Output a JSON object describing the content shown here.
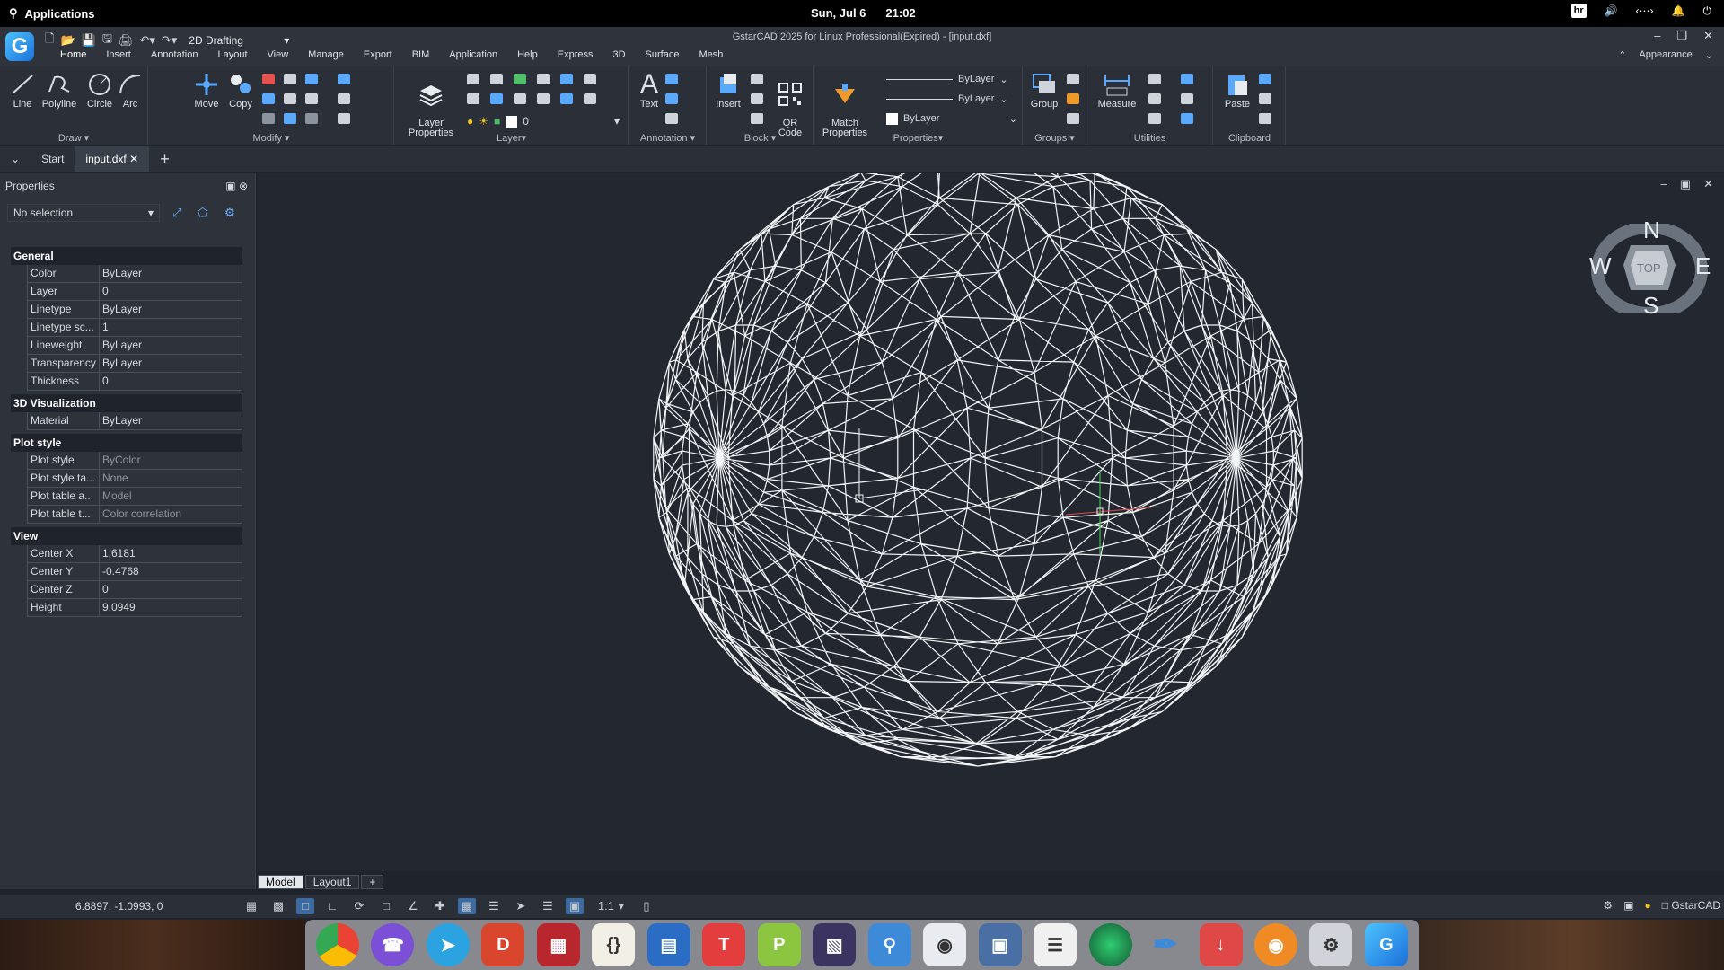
{
  "system_bar": {
    "apps_label": "Applications",
    "date": "Sun, Jul  6",
    "time": "21:02",
    "keyboard_layout": "hr"
  },
  "app": {
    "title": "GstarCAD 2025 for Linux Professional(Expired) - [input.dxf]",
    "workspace": "2D Drafting",
    "appearance_label": "Appearance",
    "menu": [
      "Home",
      "Insert",
      "Annotation",
      "Layout",
      "View",
      "Manage",
      "Export",
      "BIM",
      "Application",
      "Help",
      "Express",
      "3D",
      "Surface",
      "Mesh"
    ]
  },
  "ribbon": {
    "draw": {
      "title": "Draw",
      "line": "Line",
      "polyline": "Polyline",
      "circle": "Circle",
      "arc": "Arc"
    },
    "modify": {
      "title": "Modify",
      "move": "Move",
      "copy": "Copy"
    },
    "layer": {
      "title": "Layer",
      "layer_properties": "Layer\nProperties",
      "current_layer": "0"
    },
    "annotation": {
      "title": "Annotation",
      "text": "Text"
    },
    "block": {
      "title": "Block",
      "insert": "Insert",
      "qr_code": "QR\nCode"
    },
    "properties": {
      "title": "Properties",
      "match_properties": "Match\nProperties",
      "linetype": "ByLayer",
      "lineweight": "ByLayer",
      "color": "ByLayer"
    },
    "groups": {
      "title": "Groups",
      "group": "Group"
    },
    "utilities": {
      "title": "Utilities",
      "measure": "Measure"
    },
    "clipboard": {
      "title": "Clipboard",
      "paste": "Paste"
    }
  },
  "doc_tabs": {
    "start": "Start",
    "current": "input.dxf"
  },
  "properties_panel": {
    "title": "Properties",
    "selection": "No selection",
    "sections": [
      {
        "name": "General",
        "rows": [
          {
            "k": "Color",
            "v": "ByLayer"
          },
          {
            "k": "Layer",
            "v": "0"
          },
          {
            "k": "Linetype",
            "v": "ByLayer"
          },
          {
            "k": "Linetype sc...",
            "v": "1"
          },
          {
            "k": "Lineweight",
            "v": "ByLayer"
          },
          {
            "k": "Transparency",
            "v": "ByLayer"
          },
          {
            "k": "Thickness",
            "v": "0"
          }
        ]
      },
      {
        "name": "3D Visualization",
        "rows": [
          {
            "k": "Material",
            "v": "ByLayer"
          }
        ]
      },
      {
        "name": "Plot style",
        "rows": [
          {
            "k": "Plot style",
            "v": "ByColor"
          },
          {
            "k": "Plot style ta...",
            "v": "None"
          },
          {
            "k": "Plot table a...",
            "v": "Model"
          },
          {
            "k": "Plot table t...",
            "v": "Color correlation"
          }
        ]
      },
      {
        "name": "View",
        "rows": [
          {
            "k": "Center X",
            "v": "1.6181"
          },
          {
            "k": "Center Y",
            "v": "-0.4768"
          },
          {
            "k": "Center Z",
            "v": "0"
          },
          {
            "k": "Height",
            "v": "9.0949"
          }
        ]
      }
    ]
  },
  "viewcube": {
    "n": "N",
    "s": "S",
    "e": "E",
    "w": "W",
    "face": "TOP"
  },
  "layout_tabs": [
    "Model",
    "Layout1",
    "+"
  ],
  "status": {
    "coords": "6.8897, -1.0993, 0",
    "scale": "1:1",
    "app_name": "GstarCAD"
  },
  "dock": [
    "Chrome",
    "Viber",
    "Telegram",
    "DraftSight",
    "Terminal",
    "Brackets",
    "Writer",
    "Typora",
    "Publisher",
    "Ebook",
    "Finder",
    "Settings",
    "Store",
    "Mixer",
    "Globe",
    "Pen",
    "Downloader",
    "Blender",
    "Tools",
    "GstarCAD"
  ]
}
